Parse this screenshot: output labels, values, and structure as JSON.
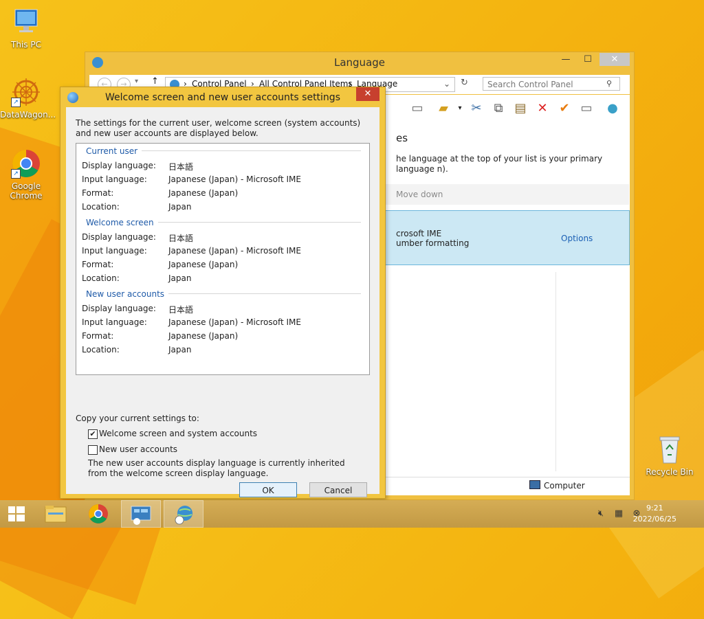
{
  "desktop": {
    "icons": [
      {
        "label": "This PC",
        "icon": "this-pc-icon"
      },
      {
        "label": "DataWagon...",
        "icon": "datawagon-icon"
      },
      {
        "label": "Google Chrome",
        "icon": "chrome-icon"
      },
      {
        "label": "Recycle Bin",
        "icon": "recycle-bin-icon"
      }
    ]
  },
  "language_window": {
    "title": "Language",
    "breadcrumb": [
      "Control Panel",
      "All Control Panel Items",
      "Language"
    ],
    "search_placeholder": "Search Control Panel",
    "heading_partial": "es",
    "description_partial": "he language at the top of your list is your primary language n).",
    "move_down": "Move down",
    "item_line1": "crosoft IME",
    "item_line2": "umber formatting",
    "options": "Options",
    "status_computer": "Computer"
  },
  "dialog": {
    "title": "Welcome screen and new user accounts settings",
    "intro": "The settings for the current user, welcome screen (system accounts) and new user accounts are displayed below.",
    "groups": [
      {
        "name": "Current user",
        "rows": [
          {
            "label": "Display language:",
            "value": "日本語"
          },
          {
            "label": "Input language:",
            "value": "Japanese (Japan) - Microsoft IME"
          },
          {
            "label": "Format:",
            "value": "Japanese (Japan)"
          },
          {
            "label": "Location:",
            "value": "Japan"
          }
        ]
      },
      {
        "name": "Welcome screen",
        "rows": [
          {
            "label": "Display language:",
            "value": "日本語"
          },
          {
            "label": "Input language:",
            "value": "Japanese (Japan) - Microsoft IME"
          },
          {
            "label": "Format:",
            "value": "Japanese (Japan)"
          },
          {
            "label": "Location:",
            "value": "Japan"
          }
        ]
      },
      {
        "name": "New user accounts",
        "rows": [
          {
            "label": "Display language:",
            "value": "日本語"
          },
          {
            "label": "Input language:",
            "value": "Japanese (Japan) - Microsoft IME"
          },
          {
            "label": "Format:",
            "value": "Japanese (Japan)"
          },
          {
            "label": "Location:",
            "value": "Japan"
          }
        ]
      }
    ],
    "copy_label": "Copy your current settings to:",
    "checkbox_welcome": {
      "label": "Welcome screen and system accounts",
      "checked": true
    },
    "checkbox_new_users": {
      "label": "New user accounts",
      "checked": false
    },
    "note": "The new user accounts display language is currently inherited from the welcome screen display language.",
    "ok": "OK",
    "cancel": "Cancel"
  },
  "taskbar": {
    "clock_time": "9:21",
    "clock_date": "2022/06/25"
  },
  "colors": {
    "accent_blue": "#1e5aa8",
    "close_red": "#c7402e",
    "selection_blue": "#cce8f4"
  }
}
